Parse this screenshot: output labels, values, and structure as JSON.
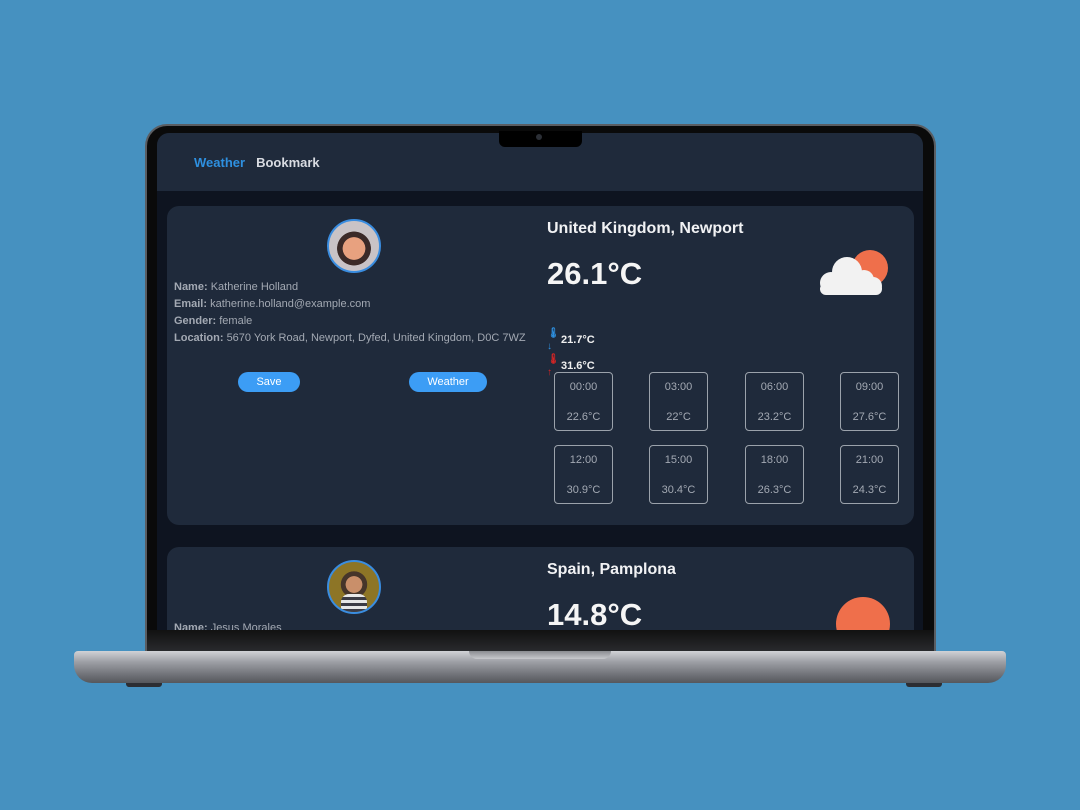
{
  "nav": {
    "items": [
      {
        "label": "Weather",
        "active": true
      },
      {
        "label": "Bookmark",
        "active": false
      }
    ]
  },
  "cards": [
    {
      "profile": {
        "name_label": "Name:",
        "name": "Katherine Holland",
        "email_label": "Email:",
        "email": "katherine.holland@example.com",
        "gender_label": "Gender:",
        "gender": "female",
        "location_label": "Location:",
        "location": "5670 York Road, Newport, Dyfed, United Kingdom, D0C 7WZ"
      },
      "buttons": {
        "save": "Save",
        "weather": "Weather"
      },
      "weather": {
        "city": "United Kingdom, Newport",
        "temperature": "26.1°C",
        "icon": "partly-cloudy-icon",
        "min": "21.7°C",
        "max": "31.6°C",
        "hourly": [
          {
            "time": "00:00",
            "temp": "22.6°C"
          },
          {
            "time": "03:00",
            "temp": "22°C"
          },
          {
            "time": "06:00",
            "temp": "23.2°C"
          },
          {
            "time": "09:00",
            "temp": "27.6°C"
          },
          {
            "time": "12:00",
            "temp": "30.9°C"
          },
          {
            "time": "15:00",
            "temp": "30.4°C"
          },
          {
            "time": "18:00",
            "temp": "26.3°C"
          },
          {
            "time": "21:00",
            "temp": "24.3°C"
          }
        ]
      }
    },
    {
      "profile": {
        "name_label": "Name:",
        "name": "Jesus Morales"
      },
      "weather": {
        "city": "Spain, Pamplona",
        "temperature": "14.8°C",
        "icon": "sun-icon"
      }
    }
  ],
  "colors": {
    "accent": "#3c9df5",
    "nav_active": "#2e90e0",
    "card_bg": "#1f2a3b",
    "page_bg": "#0e1420",
    "sun": "#ef6f4b",
    "backdrop": "#4691c0"
  }
}
